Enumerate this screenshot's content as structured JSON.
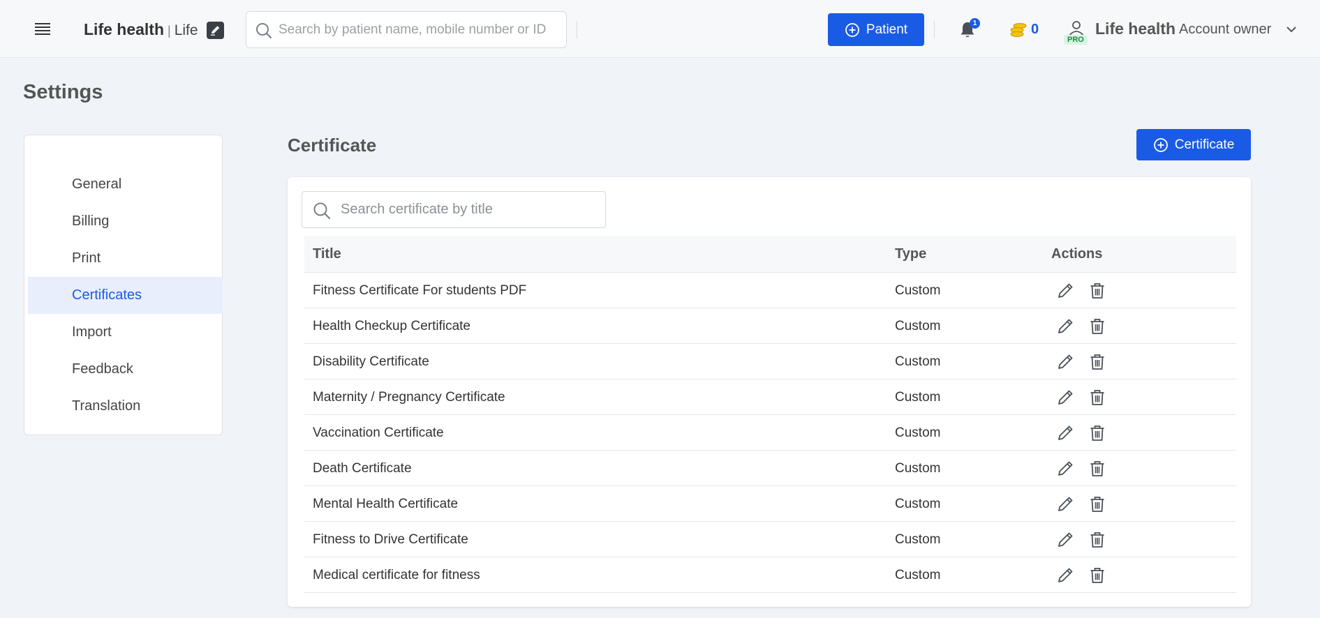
{
  "header": {
    "brand": "Life health",
    "brand_separator": "|",
    "brand_sub": "Life",
    "search_placeholder": "Search by patient name, mobile number or ID",
    "patient_button_label": "Patient",
    "notification_count": "1",
    "coin_count": "0",
    "pro_badge": "PRO",
    "account_name": "Life health",
    "account_role": "Account owner"
  },
  "page": {
    "title": "Settings"
  },
  "sidebar": {
    "items": [
      {
        "label": "General",
        "active": false
      },
      {
        "label": "Billing",
        "active": false
      },
      {
        "label": "Print",
        "active": false
      },
      {
        "label": "Certificates",
        "active": true
      },
      {
        "label": "Import",
        "active": false
      },
      {
        "label": "Feedback",
        "active": false
      },
      {
        "label": "Translation",
        "active": false
      }
    ]
  },
  "main": {
    "section_title": "Certificate",
    "add_button_label": "Certificate",
    "search_placeholder": "Search certificate by title",
    "columns": {
      "title": "Title",
      "type": "Type",
      "actions": "Actions"
    },
    "rows": [
      {
        "title": "Fitness Certificate For students PDF",
        "type": "Custom"
      },
      {
        "title": "Health Checkup Certificate",
        "type": "Custom"
      },
      {
        "title": "Disability Certificate",
        "type": "Custom"
      },
      {
        "title": "Maternity / Pregnancy Certificate",
        "type": "Custom"
      },
      {
        "title": "Vaccination Certificate",
        "type": "Custom"
      },
      {
        "title": "Death Certificate",
        "type": "Custom"
      },
      {
        "title": "Mental Health Certificate",
        "type": "Custom"
      },
      {
        "title": "Fitness to Drive Certificate",
        "type": "Custom"
      },
      {
        "title": "Medical certificate for fitness",
        "type": "Custom"
      }
    ]
  },
  "colors": {
    "accent": "#1a5be6",
    "active_bg": "#e8eefc",
    "page_bg": "#f0f3f7",
    "coin": "#f2c40f",
    "pro_green": "#1a8a45"
  }
}
